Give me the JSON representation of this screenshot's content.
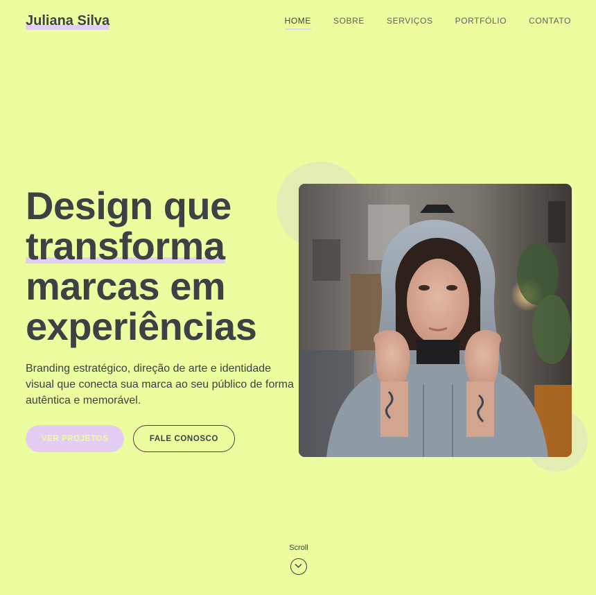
{
  "header": {
    "logo": "Juliana Silva",
    "nav": [
      {
        "label": "HOME",
        "active": true
      },
      {
        "label": "SOBRE",
        "active": false
      },
      {
        "label": "SERVIÇOS",
        "active": false
      },
      {
        "label": "PORTFÓLIO",
        "active": false
      },
      {
        "label": "CONTATO",
        "active": false
      }
    ]
  },
  "hero": {
    "title_line1": "Design que",
    "title_line2": "transforma",
    "title_line3": "marcas em",
    "title_line4": "experiências",
    "subtitle": "Branding estratégico, direção de arte e identidade visual que conecta sua marca ao seu público de forma autêntica e memorável.",
    "primary_button": "VER PROJETOS",
    "secondary_button": "FALE CONOSCO",
    "image_icon": "portrait-photo"
  },
  "scroll": {
    "label": "Scroll",
    "icon": "chevron-down-icon"
  },
  "colors": {
    "background": "#ecfd9f",
    "accent": "#e4cdf3",
    "text": "#3c4145",
    "decoration": "#e3ecb3"
  }
}
